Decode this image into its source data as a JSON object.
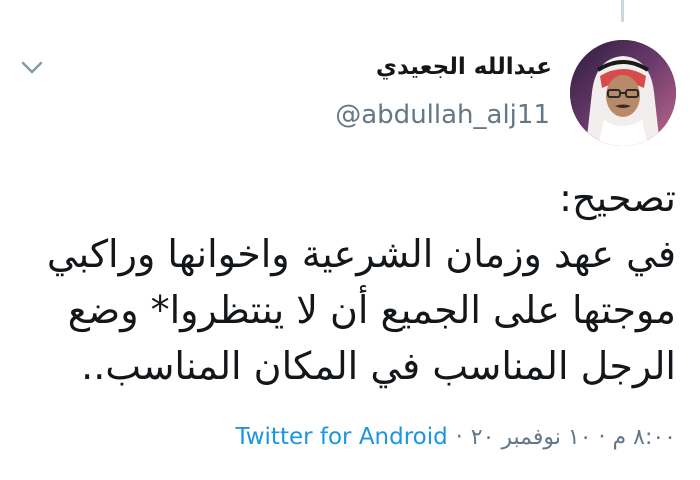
{
  "tweet": {
    "author_name": "عبدالله الجعيدي",
    "author_handle": "@abdullah_alj11",
    "text_lines": [
      "تصحيح:",
      "في عهد وزمان الشرعية واخوانها وراكبي",
      "موجتها على الجميع أن لا ينتظروا* وضع",
      "الرجل المناسب في المكان المناسب.."
    ],
    "timestamp": "٨:٠٠ م · ١٠ نوفمبر ٢٠",
    "separator": "·",
    "source": "Twitter for Android"
  },
  "icons": {
    "chevron": "chevron-down-icon",
    "avatar": "profile-avatar"
  },
  "colors": {
    "text": "#14171a",
    "secondary": "#657786",
    "link": "#1b95e0",
    "thread_line": "#ccd6dd"
  }
}
